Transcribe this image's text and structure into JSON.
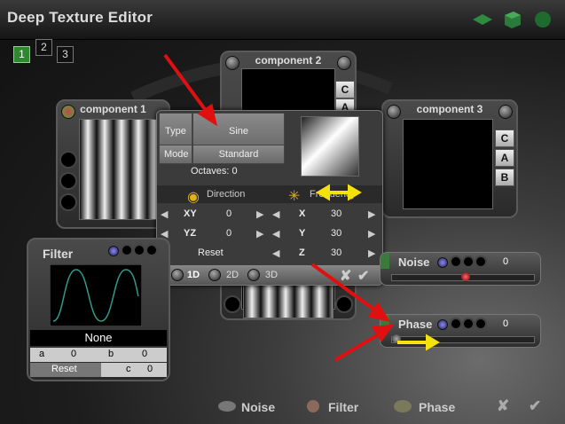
{
  "window": {
    "title": "Deep Texture Editor"
  },
  "layer_tabs": [
    "1",
    "2",
    "3"
  ],
  "components": [
    {
      "title": "component 1"
    },
    {
      "title": "component 2"
    },
    {
      "title": "component 3"
    }
  ],
  "side_buttons_c2": [
    "C",
    "A"
  ],
  "side_buttons_c3": [
    "C",
    "A",
    "B"
  ],
  "popup": {
    "type_label": "Type",
    "type_value": "Sine",
    "mode_label": "Mode",
    "mode_value": "Standard",
    "octaves": "Octaves: 0",
    "direction": "Direction",
    "frequency": "Frequency",
    "rows": [
      {
        "l_label": "XY",
        "l_value": "0",
        "r_label": "X",
        "r_value": "30"
      },
      {
        "l_label": "YZ",
        "l_value": "0",
        "r_label": "Y",
        "r_value": "30"
      },
      {
        "l_label": "Reset",
        "l_value": "",
        "r_label": "Z",
        "r_value": "30"
      }
    ],
    "dims": [
      "1D",
      "2D",
      "3D"
    ]
  },
  "filter": {
    "title": "Filter",
    "name": "None",
    "a_label": "a",
    "a_value": "0",
    "b_label": "b",
    "b_value": "0",
    "reset": "Reset",
    "c_label": "c",
    "c_value": "0"
  },
  "noise_slider": {
    "label": "Noise",
    "value": "0",
    "level": 0.52
  },
  "phase_slider": {
    "label": "Phase",
    "value": "0",
    "level": 0.0
  },
  "bottom": {
    "noise": "Noise",
    "filter": "Filter",
    "phase": "Phase"
  },
  "colors": {
    "accent_green": "#2c8a2c",
    "arrow_red": "#e01010",
    "arrow_yellow": "#f4e20a"
  }
}
